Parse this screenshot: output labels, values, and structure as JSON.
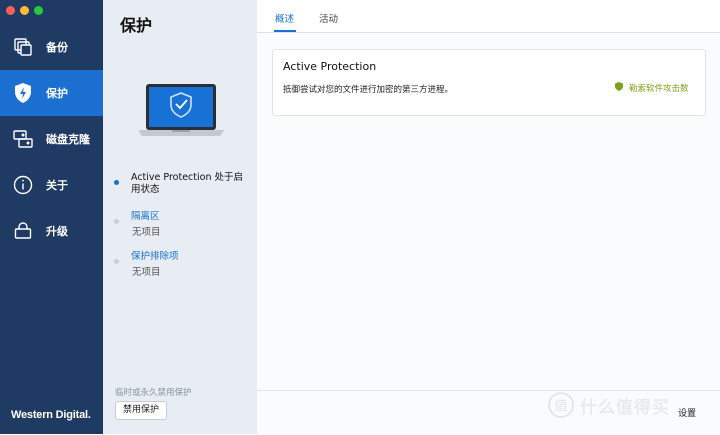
{
  "colors": {
    "nav_bg": "#1f3a63",
    "nav_active": "#1a6fd1",
    "accent": "#1a6fd1",
    "ok_green": "#7ea318",
    "traffic": [
      "#ff5f57",
      "#febc2e",
      "#28c840"
    ]
  },
  "nav": {
    "items": [
      {
        "label": "备份",
        "icon": "backup-icon"
      },
      {
        "label": "保护",
        "icon": "shield-icon",
        "active": true
      },
      {
        "label": "磁盘克隆",
        "icon": "disk-clone-icon"
      },
      {
        "label": "关于",
        "icon": "info-icon"
      },
      {
        "label": "升级",
        "icon": "cart-icon"
      }
    ],
    "brand": "Western Digital."
  },
  "middle": {
    "title": "保护",
    "status_items": [
      {
        "title": "Active Protection 处于启用状态",
        "sub": ""
      },
      {
        "title": "隔离区",
        "sub": "无项目"
      },
      {
        "title": "保护排除项",
        "sub": "无项目"
      }
    ],
    "footer_text": "临时或永久禁用保护",
    "disable_button": "禁用保护"
  },
  "main": {
    "tabs": [
      {
        "label": "概述",
        "active": true
      },
      {
        "label": "活动"
      }
    ],
    "card": {
      "title": "Active Protection",
      "description": "抵御尝试对您的文件进行加密的第三方进程。",
      "link": "勒索软件攻击数"
    },
    "settings_button": "设置"
  },
  "watermark": {
    "glyph": "值",
    "text": "什么值得买"
  }
}
